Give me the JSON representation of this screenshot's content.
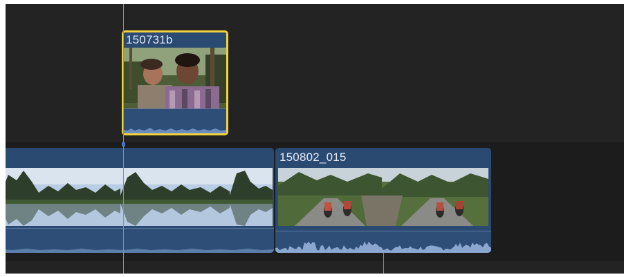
{
  "timeline": {
    "connected_clip": {
      "title": "150731b",
      "selected": true
    },
    "primary_clips": [
      {
        "title": "",
        "content": "karst-landscape-reflection"
      },
      {
        "title": "150802_015",
        "content": "motorcyclists-on-road"
      }
    ]
  },
  "colors": {
    "timeline_bg": "#232323",
    "clip_blue": "#2b4a72",
    "selection_yellow": "#f3d33b",
    "playhead": "#8f8f8f"
  }
}
